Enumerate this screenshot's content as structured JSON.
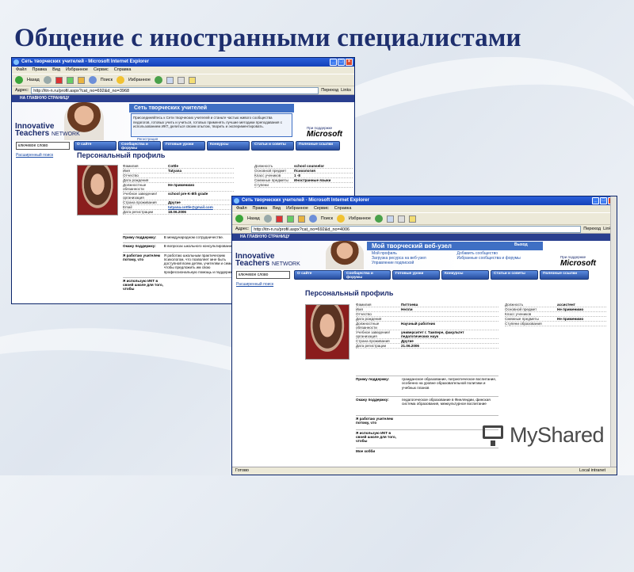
{
  "slide": {
    "title": "Общение с иностранными специалистами",
    "watermark": "MyShared"
  },
  "browser1": {
    "window_title": "Сеть творческих учителей - Microsoft Internet Explorer",
    "menu": [
      "Файл",
      "Правка",
      "Вид",
      "Избранное",
      "Сервис",
      "Справка"
    ],
    "toolbar": {
      "back": "Назад",
      "search": "Поиск",
      "favorites": "Избранное"
    },
    "address_label": "Адрес:",
    "address": "http://itn-n.ru/profil.aspx?cat_no=692&d_no=3968",
    "go": "Переход",
    "links": "Links",
    "home_link": "НА ГЛАВНУЮ СТРАНИЦУ",
    "banner_title": "Сеть творческих учителей",
    "banner_text": "Присоединяйтесь к Сети творческих учителей и станьте частью живого сообщества педагогов, готовых учить и учиться, готовых применять лучшие методики преподавания с использованием ИКТ, делиться своим опытом, творить и экспериментировать.",
    "registration": "Регистрация",
    "brand_line1": "Innovative",
    "brand_line2": "Teachers",
    "brand_line3": "NETWORK",
    "ms_small": "При поддержке",
    "ms_logo": "Microsoft",
    "search_value": "ключевое слово",
    "advanced_search": "Расширенный поиск",
    "nav": [
      "О сайте",
      "Сообщества и форумы",
      "Готовые уроки",
      "Конкурсы",
      "Статьи и советы",
      "Полезные ссылки"
    ],
    "profile_title": "Персональный профиль",
    "fields_left": [
      {
        "k": "Фамилия",
        "v": "Cottle"
      },
      {
        "k": "Имя",
        "v": "Tatyana"
      },
      {
        "k": "Отчество",
        "v": ""
      },
      {
        "k": "Дата рождения",
        "v": ""
      },
      {
        "k": "Должностные обязанности",
        "v": "Не применимо"
      },
      {
        "k": "Учебное заведение/организация",
        "v": "school pre-K-8th grade"
      },
      {
        "k": "Страна проживания",
        "v": "Другие"
      },
      {
        "k": "Email",
        "v": "tatyana.cottle@gmail.com"
      },
      {
        "k": "Дата регистрации",
        "v": "18.06.2006"
      }
    ],
    "fields_right": [
      {
        "k": "Должность",
        "v": "school counselor"
      },
      {
        "k": "Основной предмет",
        "v": "Психология"
      },
      {
        "k": "Класс учеников",
        "v": "1 -8"
      },
      {
        "k": "Смежные предметы",
        "v": "Иностранные языки"
      },
      {
        "k": "Ступени",
        "v": ""
      }
    ],
    "questions": [
      {
        "q": "Приму поддержку:",
        "a": "В международном сотрудничестве."
      },
      {
        "q": "Окажу поддержку:",
        "a": "В вопросах школьного консультирования"
      },
      {
        "q": "Я работаю учителем потому, что",
        "a": "Я работаю школьным практическим психологом, что позволяет мне быть доступной всем детям, учителям и семьям, чтобы предложить им свою профессиональную помощь и поддержку"
      },
      {
        "q": "Я использую ИКТ в своей школе для того, чтобы",
        "a": ""
      }
    ]
  },
  "browser2": {
    "window_title": "Сеть творческих учителей - Microsoft Internet Explorer",
    "menu": [
      "Файл",
      "Правка",
      "Вид",
      "Избранное",
      "Сервис",
      "Справка"
    ],
    "toolbar": {
      "back": "Назад",
      "search": "Поиск",
      "favorites": "Избранное"
    },
    "address_label": "Адрес:",
    "address": "http://itn-n.ru/profil.aspx?cat_no=692&d_no=4006",
    "go": "Переход",
    "links": "Links",
    "home_link": "НА ГЛАВНУЮ СТРАНИЦУ",
    "banner_title": "Мой творческий веб-узел",
    "banner_links": [
      "Мой профиль",
      "Загрузка ресурса на веб-узел",
      "Управление подпиской",
      "Добавить сообщество",
      "Избранные сообщества и форумы"
    ],
    "exit": "Выход",
    "brand_line1": "Innovative",
    "brand_line2": "Teachers",
    "brand_line3": "NETWORK",
    "ms_small": "При поддержке",
    "ms_logo": "Microsoft",
    "search_value": "ключевое слово",
    "advanced_search": "Расширенный поиск",
    "nav": [
      "О сайте",
      "Сообщества и форумы",
      "Готовые уроки",
      "Конкурсы",
      "Статьи и советы",
      "Полезные ссылки"
    ],
    "profile_title": "Персональный профиль",
    "fields_left": [
      {
        "k": "Фамилия",
        "v": "Питтоева"
      },
      {
        "k": "Имя",
        "v": "Нелли"
      },
      {
        "k": "Отчество",
        "v": ""
      },
      {
        "k": "Дата рождения",
        "v": ""
      },
      {
        "k": "Должностные обязанности",
        "v": "Научный работник"
      },
      {
        "k": "Учебное заведение/организация",
        "v": "университет г. Тампере, факультет педагогических наук"
      },
      {
        "k": "Страна проживания",
        "v": "Другие"
      },
      {
        "k": "Дата регистрации",
        "v": "21.06.2006"
      }
    ],
    "fields_right": [
      {
        "k": "Должность",
        "v": "ассистент"
      },
      {
        "k": "Основной предмет",
        "v": "Не применимо"
      },
      {
        "k": "Класс учеников",
        "v": ""
      },
      {
        "k": "Смежные предметы",
        "v": "Не применимо"
      },
      {
        "k": "Ступени образования",
        "v": ""
      }
    ],
    "questions": [
      {
        "q": "Приму поддержку:",
        "a": "гражданское образование, патриотическое воспитание, особенно на уровне образовательной политики и учебных планов"
      },
      {
        "q": "Окажу поддержку:",
        "a": "педагогическое образование в Финляндии, финская система образования, межкультурное воспитание"
      },
      {
        "q": "Я работаю учителем потому, что",
        "a": ""
      },
      {
        "q": "Я использую ИКТ в своей школе для того, чтобы",
        "a": ""
      },
      {
        "q": "Мое хобби",
        "a": ""
      }
    ],
    "status": "Готово",
    "zone": "Local intranet"
  }
}
